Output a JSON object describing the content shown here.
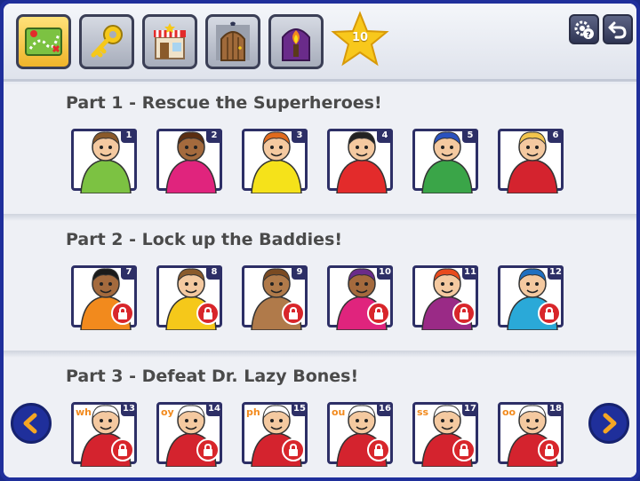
{
  "topbar": {
    "nav_buttons": [
      {
        "name": "map-button",
        "icon": "map-icon",
        "active": true
      },
      {
        "name": "key-button",
        "icon": "key-icon",
        "active": false
      },
      {
        "name": "shop-button",
        "icon": "shop-icon",
        "active": false
      },
      {
        "name": "door-button",
        "icon": "door-icon",
        "active": false
      },
      {
        "name": "torch-button",
        "icon": "torch-icon",
        "active": false
      }
    ],
    "star_count": "10",
    "settings_icon": "gear-help-icon",
    "back_icon": "back-arrow-icon"
  },
  "sections": [
    {
      "title": "Part 1 - Rescue the Superheroes!",
      "cards": [
        {
          "num": "1",
          "locked": false,
          "color": "#7cc242",
          "skin": "#f4c9a0",
          "hair": "#8a5a2b"
        },
        {
          "num": "2",
          "locked": false,
          "color": "#e0247d",
          "skin": "#a46a3d",
          "hair": "#5a2e12"
        },
        {
          "num": "3",
          "locked": false,
          "color": "#f5e21a",
          "skin": "#f4c9a0",
          "hair": "#e06a1d"
        },
        {
          "num": "4",
          "locked": false,
          "color": "#e32b2b",
          "skin": "#f4c9a0",
          "hair": "#222222"
        },
        {
          "num": "5",
          "locked": false,
          "color": "#3aa548",
          "skin": "#f4c9a0",
          "hair": "#2a52be"
        },
        {
          "num": "6",
          "locked": false,
          "color": "#d4232e",
          "skin": "#f4c9a0",
          "hair": "#f2c44d"
        }
      ]
    },
    {
      "title": "Part 2 - Lock up the Baddies!",
      "cards": [
        {
          "num": "7",
          "locked": true,
          "color": "#f28a1d",
          "skin": "#a46a3d",
          "hair": "#1a1a1a"
        },
        {
          "num": "8",
          "locked": true,
          "color": "#f5c81a",
          "skin": "#f4c9a0",
          "hair": "#8a5a2b"
        },
        {
          "num": "9",
          "locked": true,
          "color": "#b07a4a",
          "skin": "#b07a4a",
          "hair": "#7a4a22"
        },
        {
          "num": "10",
          "locked": true,
          "color": "#e0247d",
          "skin": "#a46a3d",
          "hair": "#6a2b8a"
        },
        {
          "num": "11",
          "locked": true,
          "color": "#9a2a86",
          "skin": "#f4c9a0",
          "hair": "#e84a1d"
        },
        {
          "num": "12",
          "locked": true,
          "color": "#2aa9d8",
          "skin": "#f4c9a0",
          "hair": "#1f6fc0"
        }
      ]
    },
    {
      "title": "Part 3 - Defeat Dr. Lazy Bones!",
      "cards": [
        {
          "num": "13",
          "locked": true,
          "color": "#d4232e",
          "skin": "#f4c9a0",
          "hair": "#ffffff",
          "sound": "wh"
        },
        {
          "num": "14",
          "locked": true,
          "color": "#d4232e",
          "skin": "#f4c9a0",
          "hair": "#ffffff",
          "sound": "oy"
        },
        {
          "num": "15",
          "locked": true,
          "color": "#d4232e",
          "skin": "#f4c9a0",
          "hair": "#ffffff",
          "sound": "ph"
        },
        {
          "num": "16",
          "locked": true,
          "color": "#d4232e",
          "skin": "#f4c9a0",
          "hair": "#ffffff",
          "sound": "ou"
        },
        {
          "num": "17",
          "locked": true,
          "color": "#d4232e",
          "skin": "#f4c9a0",
          "hair": "#ffffff",
          "sound": "ss"
        },
        {
          "num": "18",
          "locked": true,
          "color": "#d4232e",
          "skin": "#f4c9a0",
          "hair": "#ffffff",
          "sound": "oo"
        }
      ]
    }
  ],
  "pager": {
    "prev_icon": "chevron-left-icon",
    "next_icon": "chevron-right-icon"
  }
}
